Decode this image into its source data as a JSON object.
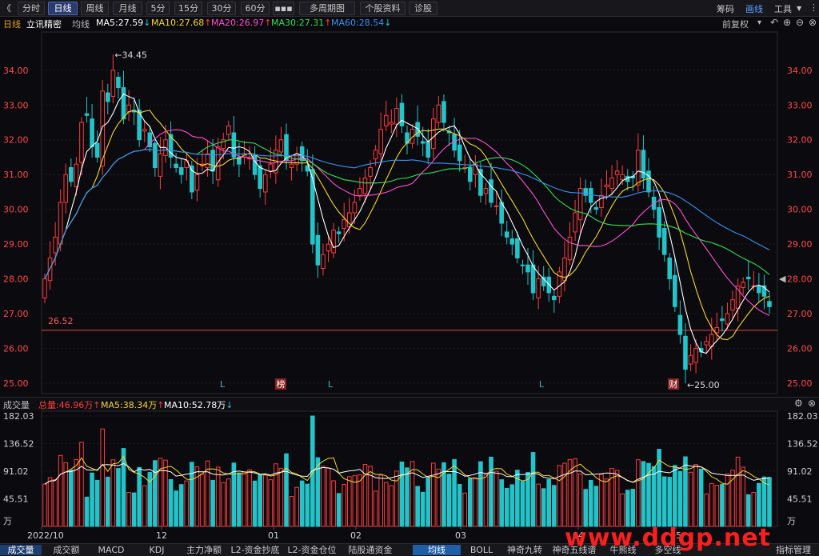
{
  "toolbar": {
    "back_glyph": "《",
    "tabs": [
      "分时",
      "日线",
      "周线",
      "月线",
      "5分",
      "15分",
      "30分",
      "60分",
      "▪▪▪",
      "多周期图",
      "个股资料",
      "诊股"
    ],
    "active_tab": 1,
    "right": [
      "筹码",
      "画线",
      "工具"
    ],
    "right_active": 1
  },
  "info": {
    "period": "日线",
    "name": "立讯精密",
    "ma_label": "均线",
    "ma5": "MA5:27.59",
    "ma10": "MA10:27.68",
    "ma20": "MA20:26.97",
    "ma30": "MA30:27.31",
    "ma60": "MA60:28.54",
    "adjust": "前复权",
    "colors": {
      "ma5": "#ffffff",
      "ma10": "#f5d531",
      "ma20": "#ff4fcf",
      "ma30": "#33dd55",
      "ma60": "#3a8ff0",
      "up": "#ff3b3b",
      "down": "#22c4c9"
    }
  },
  "volume_info": {
    "label": "成交量",
    "total": "总量:46.96万",
    "ma5": "MA5:38.34万",
    "ma10": "MA10:52.78万",
    "unit": "万"
  },
  "price_axis": [
    "34.00",
    "33.00",
    "32.00",
    "31.00",
    "30.00",
    "29.00",
    "28.00",
    "27.00",
    "26.00",
    "25.00"
  ],
  "volume_axis": [
    "182.03",
    "136.52",
    "91.02",
    "45.51"
  ],
  "date_axis": [
    "2022/10",
    "12",
    "01",
    "02",
    "03",
    "04",
    "05"
  ],
  "annotations": {
    "high": "34.45",
    "low": "25.00",
    "support": "26.52",
    "markers": [
      "L",
      "榜",
      "L",
      "L",
      "财"
    ]
  },
  "bottom_tabs": [
    "成交量",
    "成交额",
    "MACD",
    "KDJ",
    "主力净额",
    "L2-资金抄底",
    "L2-资金仓位",
    "陆股通资金",
    "均线",
    "BOLL",
    "神奇九转",
    "神奇五线谱",
    "牛熊线",
    "多空线",
    "指标管理"
  ],
  "bottom_active": [
    0,
    8
  ],
  "watermark": "www.ddgp.net",
  "chart_data": {
    "type": "candlestick",
    "y_range": [
      24.7,
      35.1
    ],
    "closes": [
      28.0,
      28.6,
      29.2,
      30.2,
      31.0,
      30.8,
      31.3,
      32.5,
      32.7,
      31.8,
      31.5,
      33.4,
      33.1,
      34.0,
      33.5,
      32.6,
      33.0,
      32.8,
      32.0,
      32.3,
      31.8,
      31.2,
      31.6,
      32.0,
      31.5,
      31.2,
      31.0,
      31.4,
      30.5,
      31.0,
      31.3,
      31.6,
      31.1,
      31.8,
      32.0,
      32.4,
      31.5,
      31.3,
      31.6,
      31.5,
      31.0,
      30.6,
      31.0,
      31.3,
      31.7,
      32.0,
      31.4,
      31.3,
      31.6,
      31.4,
      31.1,
      29.0,
      28.4,
      28.7,
      29.0,
      29.4,
      29.3,
      29.7,
      29.9,
      30.2,
      30.6,
      30.9,
      31.2,
      31.7,
      32.3,
      32.7,
      32.5,
      32.9,
      32.4,
      31.9,
      32.3,
      32.1,
      31.9,
      31.5,
      32.6,
      33.0,
      32.5,
      32.2,
      31.7,
      31.4,
      31.2,
      30.8,
      31.3,
      30.4,
      30.6,
      30.2,
      30.1,
      29.6,
      29.2,
      29.0,
      28.6,
      28.4,
      28.2,
      27.6,
      28.0,
      27.8,
      27.6,
      27.4,
      28.2,
      28.6,
      29.2,
      29.9,
      30.6,
      30.4,
      30.2,
      30.0,
      30.4,
      30.7,
      30.9,
      31.1,
      31.0,
      30.8,
      30.9,
      31.7,
      30.9,
      30.5,
      30.0,
      29.2,
      28.7,
      28.0,
      27.2,
      26.4,
      25.4,
      25.8,
      26.0,
      25.9,
      26.2,
      26.4,
      26.6,
      26.8,
      27.0,
      27.4,
      27.8,
      27.9,
      28.0,
      27.8,
      27.6,
      27.5,
      27.2
    ]
  }
}
